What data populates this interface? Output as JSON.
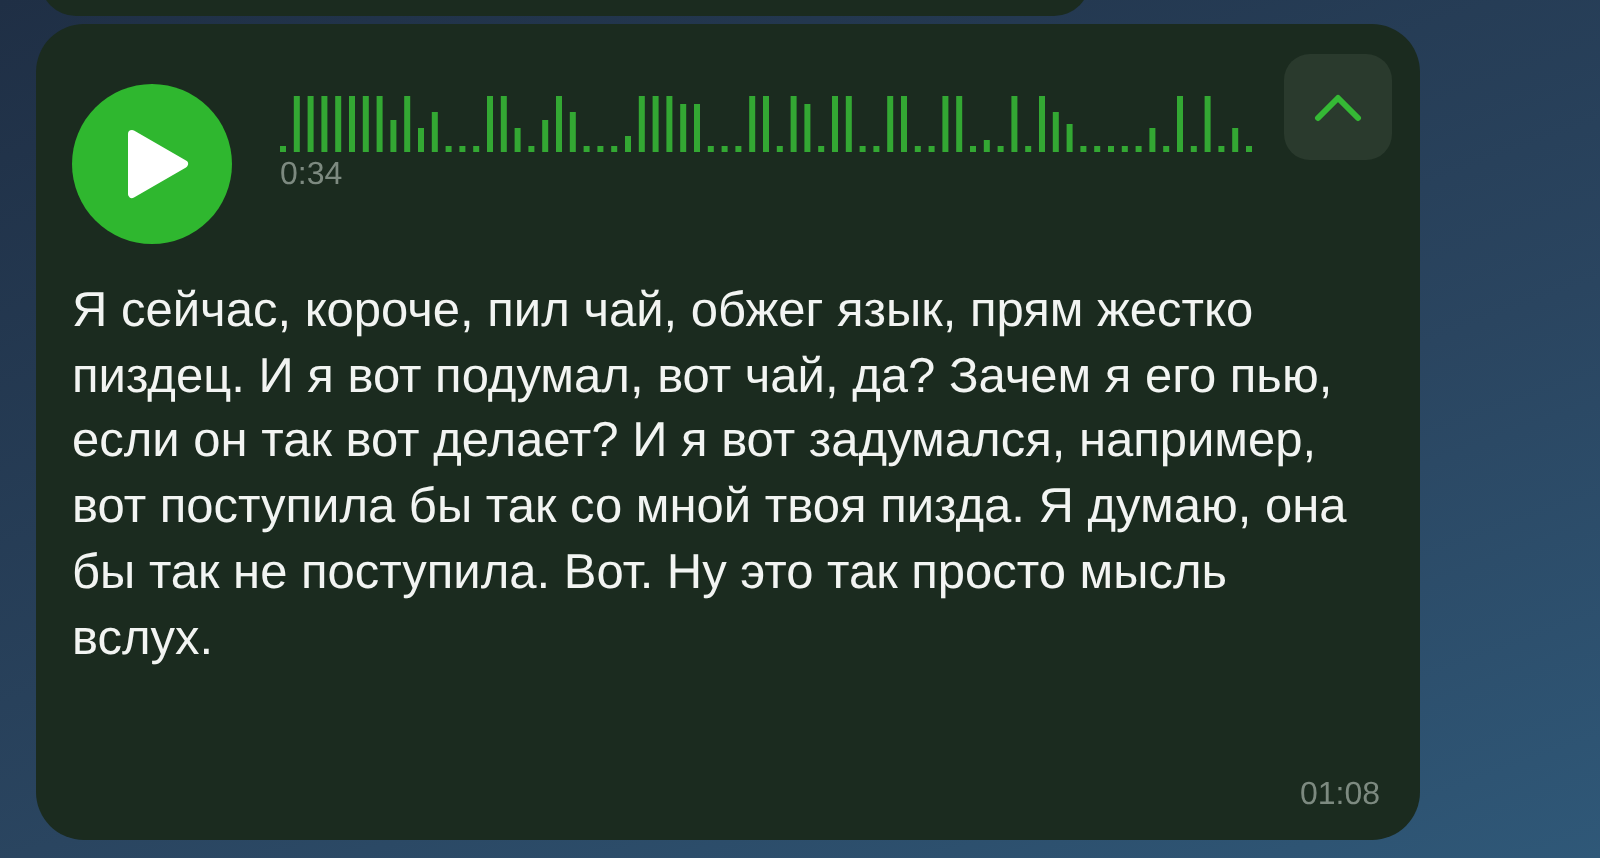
{
  "voice_message": {
    "playing": false,
    "duration": "0:34",
    "transcription_expanded": true,
    "transcript": "Я сейчас, короче, пил чай, обжег язык, прям жестко пиздец. И я вот подумал, вот чай, да? Зачем я его пью, если он так вот делает? И я вот задумался, например, вот поступила бы так со мной твоя пизда. Я думаю, она бы так не поступила. Вот. Ну это так просто мысль вслух.",
    "time": "01:08"
  }
}
